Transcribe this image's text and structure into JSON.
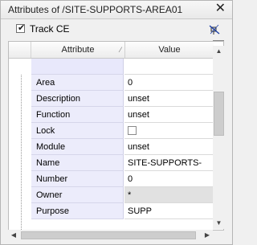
{
  "window": {
    "title": "Attributes of /SITE-SUPPORTS-AREA01",
    "close_icon": "close-icon"
  },
  "track": {
    "label": "Track CE",
    "checked": true
  },
  "toolbar": {
    "pin_icon": "unpin-icon"
  },
  "table": {
    "headers": {
      "attribute": "Attribute",
      "value": "Value"
    },
    "rows": [
      {
        "attribute": "",
        "value": ""
      },
      {
        "attribute": "Area",
        "value": "0"
      },
      {
        "attribute": "Description",
        "value": "unset"
      },
      {
        "attribute": "Function",
        "value": "unset"
      },
      {
        "attribute": "Lock",
        "value": "",
        "checkbox": true
      },
      {
        "attribute": "Module",
        "value": "unset"
      },
      {
        "attribute": "Name",
        "value": "SITE-SUPPORTS-"
      },
      {
        "attribute": "Number",
        "value": "0"
      },
      {
        "attribute": "Owner",
        "value": "*",
        "readonly": true
      },
      {
        "attribute": "Purpose",
        "value": "SUPP"
      }
    ]
  },
  "colors": {
    "attribute_cell_bg": "#ececfb",
    "readonly_bg": "#e1e1e1"
  }
}
